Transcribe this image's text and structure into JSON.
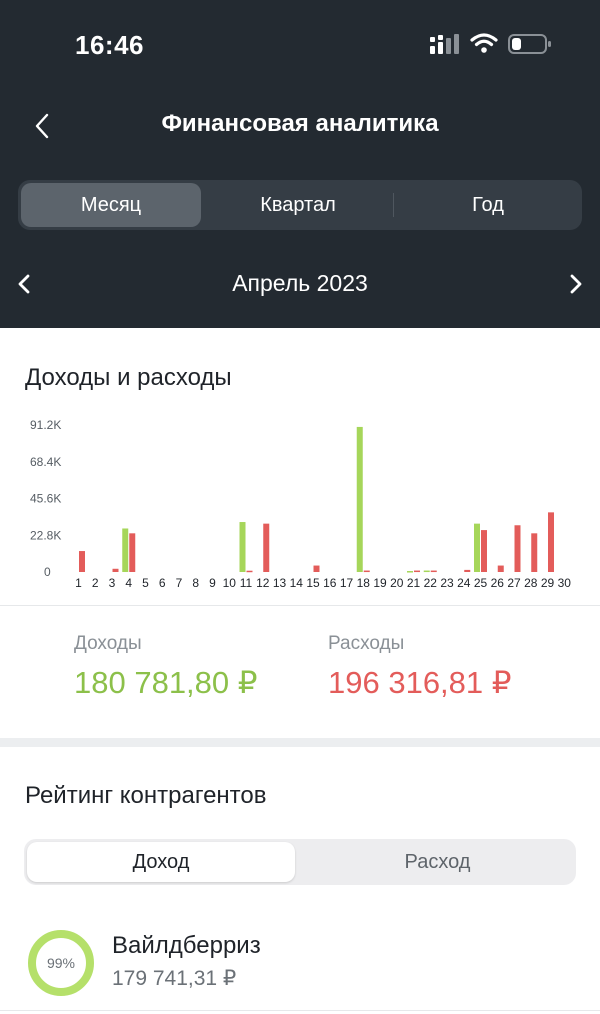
{
  "status": {
    "time": "16:46"
  },
  "header": {
    "title": "Финансовая аналитика"
  },
  "period_tabs": [
    {
      "label": "Месяц",
      "active": true
    },
    {
      "label": "Квартал",
      "active": false
    },
    {
      "label": "Год",
      "active": false
    }
  ],
  "month": {
    "label": "Апрель 2023"
  },
  "chart_section": {
    "title": "Доходы и расходы"
  },
  "chart_data": {
    "type": "bar",
    "categories": [
      "1",
      "2",
      "3",
      "4",
      "5",
      "6",
      "7",
      "8",
      "9",
      "10",
      "11",
      "12",
      "13",
      "14",
      "15",
      "16",
      "17",
      "18",
      "19",
      "20",
      "21",
      "22",
      "23",
      "24",
      "25",
      "26",
      "27",
      "28",
      "29",
      "30"
    ],
    "y_ticks": [
      "0",
      "22.8K",
      "45.6K",
      "68.4K",
      "91.2K"
    ],
    "ylim": [
      0,
      91200
    ],
    "grid": false,
    "legend": "none",
    "series": [
      {
        "color": "#a6d65a",
        "values": [
          0,
          0,
          0,
          27000,
          0,
          0,
          0,
          0,
          0,
          0,
          31000,
          0,
          0,
          0,
          0,
          0,
          0,
          90000,
          0,
          0,
          600,
          900,
          0,
          0,
          30000,
          0,
          0,
          0,
          0,
          0
        ]
      },
      {
        "color": "#e35c5a",
        "values": [
          13000,
          0,
          2000,
          24000,
          0,
          0,
          0,
          0,
          0,
          0,
          800,
          30000,
          0,
          0,
          4000,
          0,
          0,
          900,
          0,
          0,
          900,
          900,
          0,
          1300,
          26000,
          4000,
          29000,
          24000,
          37000,
          0
        ]
      }
    ]
  },
  "summary": {
    "income_label": "Доходы",
    "income_value": "180 781,80 ₽",
    "expense_label": "Расходы",
    "expense_value": "196 316,81 ₽"
  },
  "rating": {
    "title": "Рейтинг контрагентов",
    "tabs": [
      {
        "label": "Доход",
        "active": true
      },
      {
        "label": "Расход",
        "active": false
      }
    ],
    "items": [
      {
        "name": "Вайлдберриз",
        "amount": "179 741,31 ₽",
        "percent_label": "99%",
        "percent": 99
      }
    ]
  },
  "colors": {
    "income": "#8cc04a",
    "expense": "#e35c5a",
    "header_bg": "#232a31",
    "ring": "#b5e06a"
  },
  "icons": [
    "signal-icon",
    "wifi-icon",
    "battery-icon",
    "back-arrow-icon",
    "chevron-left-icon",
    "chevron-right-icon"
  ]
}
